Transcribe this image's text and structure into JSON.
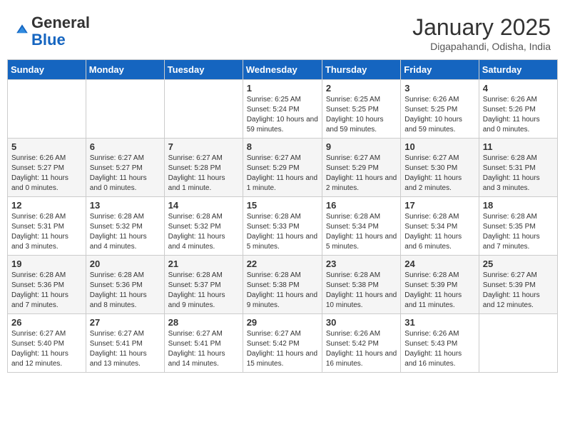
{
  "logo": {
    "general": "General",
    "blue": "Blue"
  },
  "header": {
    "month": "January 2025",
    "location": "Digapahandi, Odisha, India"
  },
  "weekdays": [
    "Sunday",
    "Monday",
    "Tuesday",
    "Wednesday",
    "Thursday",
    "Friday",
    "Saturday"
  ],
  "weeks": [
    [
      {
        "day": "",
        "info": ""
      },
      {
        "day": "",
        "info": ""
      },
      {
        "day": "",
        "info": ""
      },
      {
        "day": "1",
        "info": "Sunrise: 6:25 AM\nSunset: 5:24 PM\nDaylight: 10 hours and 59 minutes."
      },
      {
        "day": "2",
        "info": "Sunrise: 6:25 AM\nSunset: 5:25 PM\nDaylight: 10 hours and 59 minutes."
      },
      {
        "day": "3",
        "info": "Sunrise: 6:26 AM\nSunset: 5:25 PM\nDaylight: 10 hours and 59 minutes."
      },
      {
        "day": "4",
        "info": "Sunrise: 6:26 AM\nSunset: 5:26 PM\nDaylight: 11 hours and 0 minutes."
      }
    ],
    [
      {
        "day": "5",
        "info": "Sunrise: 6:26 AM\nSunset: 5:27 PM\nDaylight: 11 hours and 0 minutes."
      },
      {
        "day": "6",
        "info": "Sunrise: 6:27 AM\nSunset: 5:27 PM\nDaylight: 11 hours and 0 minutes."
      },
      {
        "day": "7",
        "info": "Sunrise: 6:27 AM\nSunset: 5:28 PM\nDaylight: 11 hours and 1 minute."
      },
      {
        "day": "8",
        "info": "Sunrise: 6:27 AM\nSunset: 5:29 PM\nDaylight: 11 hours and 1 minute."
      },
      {
        "day": "9",
        "info": "Sunrise: 6:27 AM\nSunset: 5:29 PM\nDaylight: 11 hours and 2 minutes."
      },
      {
        "day": "10",
        "info": "Sunrise: 6:27 AM\nSunset: 5:30 PM\nDaylight: 11 hours and 2 minutes."
      },
      {
        "day": "11",
        "info": "Sunrise: 6:28 AM\nSunset: 5:31 PM\nDaylight: 11 hours and 3 minutes."
      }
    ],
    [
      {
        "day": "12",
        "info": "Sunrise: 6:28 AM\nSunset: 5:31 PM\nDaylight: 11 hours and 3 minutes."
      },
      {
        "day": "13",
        "info": "Sunrise: 6:28 AM\nSunset: 5:32 PM\nDaylight: 11 hours and 4 minutes."
      },
      {
        "day": "14",
        "info": "Sunrise: 6:28 AM\nSunset: 5:32 PM\nDaylight: 11 hours and 4 minutes."
      },
      {
        "day": "15",
        "info": "Sunrise: 6:28 AM\nSunset: 5:33 PM\nDaylight: 11 hours and 5 minutes."
      },
      {
        "day": "16",
        "info": "Sunrise: 6:28 AM\nSunset: 5:34 PM\nDaylight: 11 hours and 5 minutes."
      },
      {
        "day": "17",
        "info": "Sunrise: 6:28 AM\nSunset: 5:34 PM\nDaylight: 11 hours and 6 minutes."
      },
      {
        "day": "18",
        "info": "Sunrise: 6:28 AM\nSunset: 5:35 PM\nDaylight: 11 hours and 7 minutes."
      }
    ],
    [
      {
        "day": "19",
        "info": "Sunrise: 6:28 AM\nSunset: 5:36 PM\nDaylight: 11 hours and 7 minutes."
      },
      {
        "day": "20",
        "info": "Sunrise: 6:28 AM\nSunset: 5:36 PM\nDaylight: 11 hours and 8 minutes."
      },
      {
        "day": "21",
        "info": "Sunrise: 6:28 AM\nSunset: 5:37 PM\nDaylight: 11 hours and 9 minutes."
      },
      {
        "day": "22",
        "info": "Sunrise: 6:28 AM\nSunset: 5:38 PM\nDaylight: 11 hours and 9 minutes."
      },
      {
        "day": "23",
        "info": "Sunrise: 6:28 AM\nSunset: 5:38 PM\nDaylight: 11 hours and 10 minutes."
      },
      {
        "day": "24",
        "info": "Sunrise: 6:28 AM\nSunset: 5:39 PM\nDaylight: 11 hours and 11 minutes."
      },
      {
        "day": "25",
        "info": "Sunrise: 6:27 AM\nSunset: 5:39 PM\nDaylight: 11 hours and 12 minutes."
      }
    ],
    [
      {
        "day": "26",
        "info": "Sunrise: 6:27 AM\nSunset: 5:40 PM\nDaylight: 11 hours and 12 minutes."
      },
      {
        "day": "27",
        "info": "Sunrise: 6:27 AM\nSunset: 5:41 PM\nDaylight: 11 hours and 13 minutes."
      },
      {
        "day": "28",
        "info": "Sunrise: 6:27 AM\nSunset: 5:41 PM\nDaylight: 11 hours and 14 minutes."
      },
      {
        "day": "29",
        "info": "Sunrise: 6:27 AM\nSunset: 5:42 PM\nDaylight: 11 hours and 15 minutes."
      },
      {
        "day": "30",
        "info": "Sunrise: 6:26 AM\nSunset: 5:42 PM\nDaylight: 11 hours and 16 minutes."
      },
      {
        "day": "31",
        "info": "Sunrise: 6:26 AM\nSunset: 5:43 PM\nDaylight: 11 hours and 16 minutes."
      },
      {
        "day": "",
        "info": ""
      }
    ]
  ]
}
